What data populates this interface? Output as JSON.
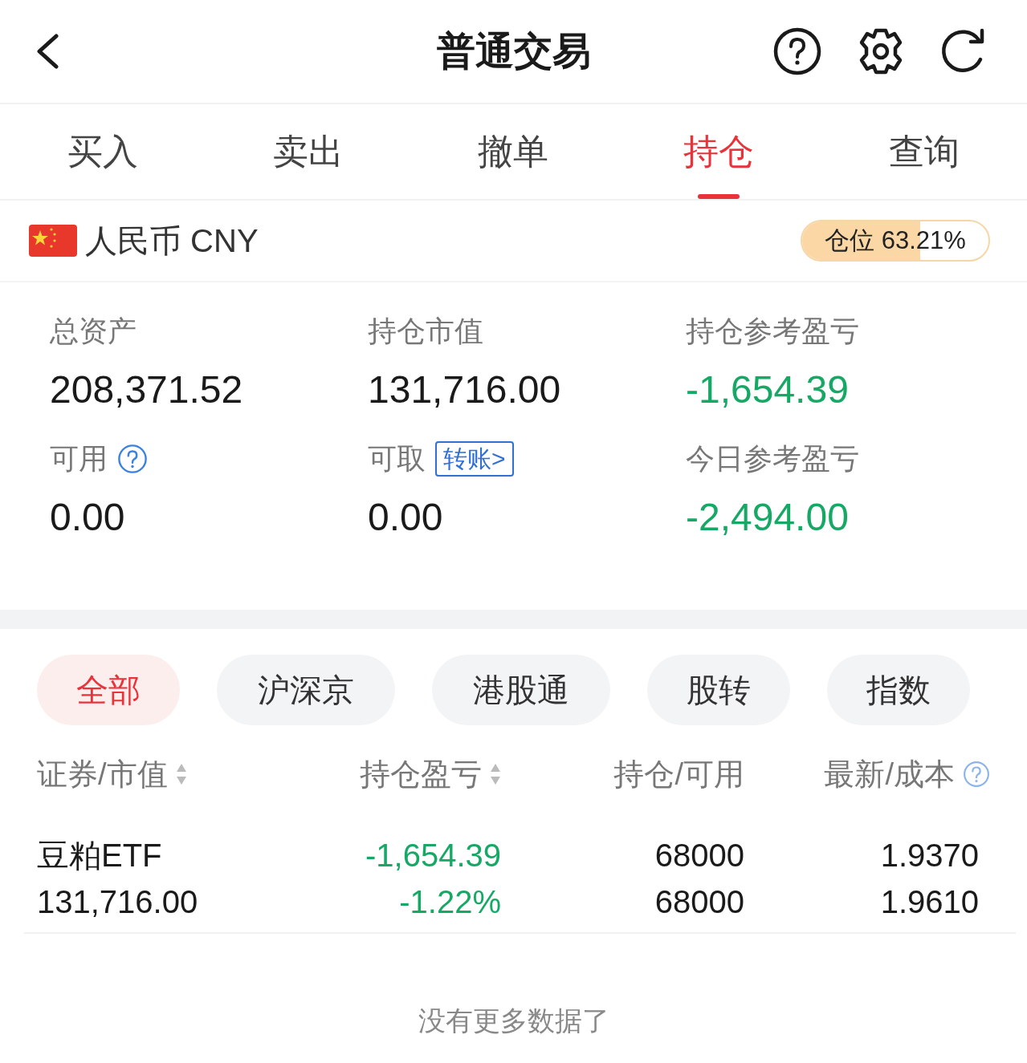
{
  "header": {
    "title": "普通交易"
  },
  "tabs": [
    {
      "label": "买入",
      "selected": false
    },
    {
      "label": "卖出",
      "selected": false
    },
    {
      "label": "撤单",
      "selected": false
    },
    {
      "label": "持仓",
      "selected": true
    },
    {
      "label": "查询",
      "selected": false
    }
  ],
  "account": {
    "currency": "人民币 CNY",
    "position": {
      "label": "仓位 63.21%",
      "level": 0.6321
    }
  },
  "stats": [
    {
      "label": "总资产",
      "value": "208,371.52",
      "color": "#1a1a1a"
    },
    {
      "label": "持仓市值",
      "value": "131,716.00",
      "color": "#1a1a1a"
    },
    {
      "label": "持仓参考盈亏",
      "value": "-1,654.39",
      "color": "#17a866"
    },
    {
      "label": "可用",
      "value": "0.00",
      "color": "#1a1a1a",
      "extra": {
        "kind": "help"
      }
    },
    {
      "label": "可取",
      "value": "0.00",
      "color": "#1a1a1a",
      "extra": {
        "kind": "link",
        "text": "转账>"
      }
    },
    {
      "label": "今日参考盈亏",
      "value": "-2,494.00",
      "color": "#17a866"
    }
  ],
  "filters": [
    {
      "label": "全部",
      "selected": true
    },
    {
      "label": "沪深京",
      "selected": false
    },
    {
      "label": "港股通",
      "selected": false
    },
    {
      "label": "股转",
      "selected": false
    },
    {
      "label": "指数",
      "selected": false
    }
  ],
  "table": {
    "columns": [
      {
        "label": "证券/市值",
        "kind": "sortable"
      },
      {
        "label": "持仓盈亏",
        "kind": "sortable"
      },
      {
        "label": "持仓/可用",
        "kind": "plain"
      },
      {
        "label": "最新/成本",
        "kind": "info"
      }
    ],
    "rows": [
      {
        "name": "豆粕ETF",
        "market_value": "131,716.00",
        "pnl": "-1,654.39",
        "pnl_pct": "-1.22%",
        "color": "#17a866",
        "holding": "68000",
        "available": "68000",
        "last": "1.9370",
        "cost": "1.9610"
      }
    ]
  },
  "footer": "没有更多数据了"
}
